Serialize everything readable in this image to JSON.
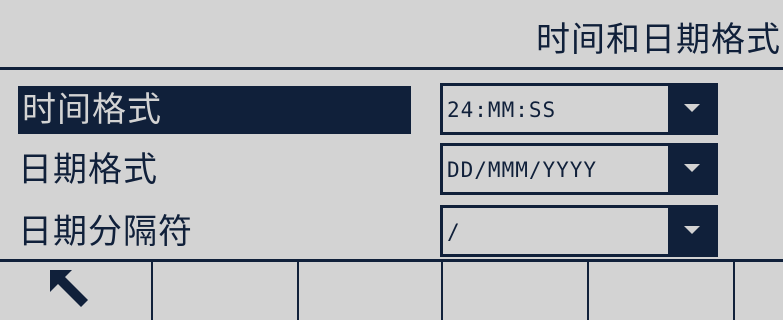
{
  "header": {
    "title": "时间和日期格式"
  },
  "settings": [
    {
      "label": "时间格式",
      "value": "24:MM:SS",
      "selected": true
    },
    {
      "label": "日期格式",
      "value": "DD/MMM/YYYY",
      "selected": false
    },
    {
      "label": "日期分隔符",
      "value": "/",
      "selected": false
    }
  ],
  "softkeys": [
    {
      "icon": "back-arrow-icon"
    },
    {
      "icon": ""
    },
    {
      "icon": ""
    },
    {
      "icon": ""
    },
    {
      "icon": ""
    },
    {
      "icon": ""
    }
  ],
  "colors": {
    "background": "#d3d3d3",
    "foreground": "#10203a"
  }
}
